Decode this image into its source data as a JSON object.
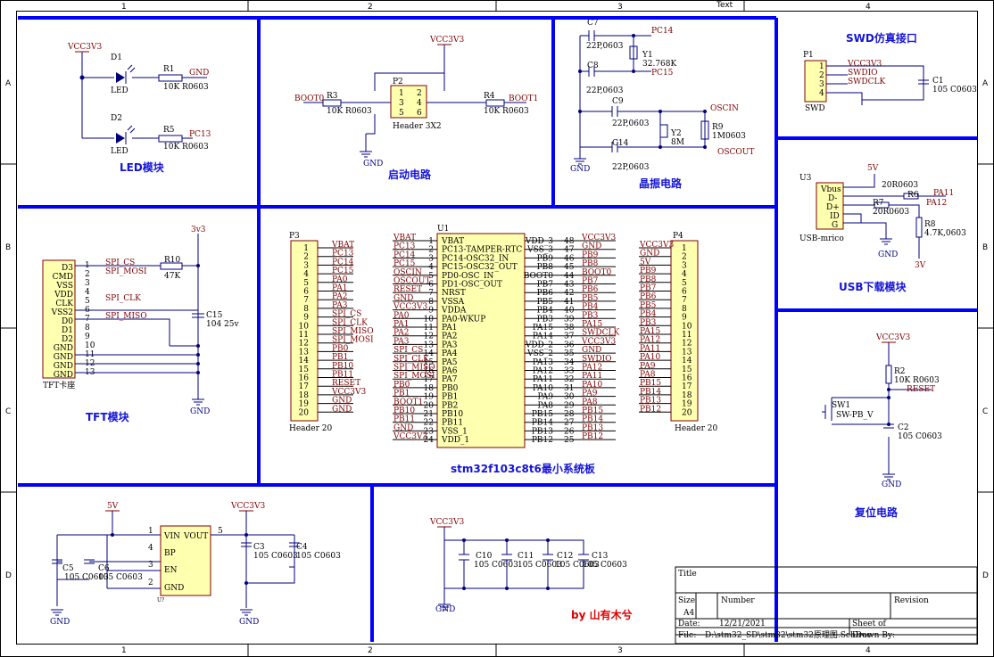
{
  "frame": {
    "cols": [
      "1",
      "2",
      "3",
      "4"
    ],
    "rows": [
      "A",
      "B",
      "C",
      "D"
    ],
    "top_text": "Text"
  },
  "sections": {
    "led": "LED模块",
    "boot": "启动电路",
    "crystal": "晶振电路",
    "swd": "SWD仿真接口",
    "usb": "USB下载模块",
    "tft": "TFT模块",
    "mcu": "stm32f103c8t6最小系统板",
    "reset": "复位电路",
    "author": "by 山有木兮"
  },
  "nets": {
    "vcc3v3": "VCC3V3",
    "gnd": "GND",
    "v5": "5V",
    "v3": "3V",
    "v3v3": "3v3",
    "pc13": "PC13",
    "pc14": "PC14",
    "pc15": "PC15",
    "oscin": "OSCIN",
    "oscout": "OSCOUT",
    "boot0": "BOOT0",
    "boot1": "BOOT1",
    "pa11": "PA11",
    "pa12": "PA12",
    "reset": "RESET",
    "swdio": "SWDIO",
    "swdclk": "SWDCLK",
    "spi_cs": "SPI_CS",
    "spi_mosi": "SPI_MOSI",
    "spi_clk": "SPI_CLK",
    "spi_miso": "SPI_MISO"
  },
  "parts": {
    "d1": "D1",
    "d2": "D2",
    "led": "LED",
    "r1": "R1",
    "r1v": "10K R0603",
    "r5": "R5",
    "r5v": "10K R0603",
    "p2": "P2",
    "p2v": "Header 3X2",
    "r3": "R3",
    "r3v": "10K R0603",
    "r4": "R4",
    "r4v": "10K R0603",
    "c7": "C7",
    "c7v": "22P,0603",
    "c8": "C8",
    "c8v": "22P,0603",
    "c9": "C9",
    "c9v": "22P,0603",
    "c14": "C14",
    "c14v": "22P,0603",
    "y1": "Y1",
    "y1v": "32.768K",
    "y2": "Y2",
    "y2v": "8M",
    "r9": "R9",
    "r9v": "1M0603",
    "p1": "P1",
    "p1v": "SWD",
    "c1": "C1",
    "c1v": "105 C0603",
    "u3": "U3",
    "u3v": "USB-mrico",
    "r6": "R6",
    "r6v": "20R0603",
    "r7": "R7",
    "r7v": "20R0603",
    "r8": "R8",
    "r8v": "4.7K,0603",
    "r10": "R10",
    "r10v": "47K",
    "c15": "C15",
    "c15v": "104 25v",
    "tft": "TFT卡座",
    "p3": "P3",
    "p3v": "Header 20",
    "p4": "P4",
    "p4v": "Header 20",
    "u1": "U1",
    "r2": "R2",
    "r2v": "10K R0603",
    "sw1": "SW1",
    "sw1v": "SW-PB_V",
    "c2": "C2",
    "c2v": "105 C0603",
    "c3": "C3",
    "c3v": "105 C0603",
    "c4": "C4",
    "c4v": "105 C0603",
    "c5": "C5",
    "c5v": "105 C0603",
    "c6": "C6",
    "c6v": "105 C0603",
    "c10": "C10",
    "c10v": "105 C0603",
    "c11": "C11",
    "c11v": "105 C0603",
    "c12": "C12",
    "c12v": "105 C0603",
    "c13": "C13",
    "c13v": "105 C0603",
    "u2": "U?"
  },
  "ldo_pins": {
    "vin": "VIN",
    "vout": "VOUT",
    "bp": "BP",
    "en": "EN",
    "gnd": "GND",
    "n1": "1",
    "n5": "5",
    "n4": "4",
    "n3": "3",
    "n2": "2"
  },
  "usb_pins": [
    "Vbus",
    "D-",
    "D+",
    "ID",
    "G"
  ],
  "tft_pins": [
    "D3",
    "CMD",
    "VSS",
    "VDD",
    "CLK",
    "VSS2",
    "D0",
    "D1",
    "D2",
    "GND",
    "GND",
    "GND",
    "GND"
  ],
  "swd_nums": [
    "1",
    "2",
    "3",
    "4"
  ],
  "mcu_left": [
    "VBAT",
    "PC13-TAMPER-RTC",
    "PC14-OSC32_IN",
    "PC15-OSC32_OUT",
    "PD0-OSC_IN",
    "PD1-OSC_OUT",
    "NRST",
    "VSSA",
    "VDDA",
    "PA0-WKUP",
    "PA1",
    "PA2",
    "PA3",
    "PA4",
    "PA5",
    "PA6",
    "PA7",
    "PB0",
    "PB1",
    "PB2",
    "PB10",
    "PB11",
    "VSS_1",
    "VDD_1"
  ],
  "mcu_left_net": [
    "VBAT",
    "PC13",
    "PC14",
    "PC15",
    "OSCIN",
    "OSCOUT",
    "RESET",
    "GND",
    "VCC3V3",
    "PA0",
    "PA1",
    "PA2",
    "PA3",
    "SPI_CS",
    "SPI_CLK",
    "SPI_MISO",
    "SPI_MOSI",
    "PB0",
    "PB1",
    "BOOT1",
    "PB10",
    "PB11",
    "GND",
    "VCC3V3"
  ],
  "mcu_right": [
    "VDD_3",
    "VSS_3",
    "PB9",
    "PB8",
    "BOOT0",
    "PB7",
    "PB6",
    "PB5",
    "PB4",
    "PB3",
    "PA15",
    "PA14",
    "VDD_2",
    "VSS_2",
    "PA13",
    "PA12",
    "PA11",
    "PA10",
    "PA9",
    "PA8",
    "PB15",
    "PB14",
    "PB13",
    "PB12"
  ],
  "mcu_right_num": [
    "48",
    "47",
    "46",
    "45",
    "44",
    "43",
    "42",
    "41",
    "40",
    "39",
    "38",
    "37",
    "36",
    "35",
    "34",
    "33",
    "32",
    "31",
    "30",
    "29",
    "28",
    "27",
    "26",
    "25"
  ],
  "mcu_right_net": [
    "VCC3V3",
    "GND",
    "PB9",
    "PB8",
    "BOOT0",
    "PB7",
    "PB6",
    "PB5",
    "PB4",
    "PB3",
    "PA15",
    "SWDCLK",
    "VCC3V3",
    "GND",
    "SWDIO",
    "PA12",
    "PA11",
    "PA10",
    "PA9",
    "PA8",
    "PB15",
    "PB14",
    "PB13",
    "PB12"
  ],
  "p3_nets": [
    "VBAT",
    "PC13",
    "PC14",
    "PC15",
    "PA0",
    "PA1",
    "PA2",
    "PA3",
    "SPI_CS",
    "SPI_CLK",
    "SPI_MISO",
    "SPI_MOSI",
    "PB0",
    "PB1",
    "PB10",
    "PB11",
    "RESET",
    "VCC3V3",
    "GND",
    "GND"
  ],
  "p4_nets": [
    "VCC3V3",
    "GND",
    "5V",
    "PB9",
    "PB8",
    "PB7",
    "PB6",
    "PB5",
    "PB4",
    "PB3",
    "PA15",
    "PA12",
    "PA11",
    "PA10",
    "PA9",
    "PA8",
    "PB15",
    "PB14",
    "PB13",
    "PB12"
  ],
  "titleblock": {
    "title": "Title",
    "size": "Size",
    "size_v": "A4",
    "number": "Number",
    "revision": "Revision",
    "date": "Date:",
    "date_v": "12/21/2021",
    "sheet": "Sheet    of",
    "file": "File:",
    "file_v": "D:\\stm32_SD\\stm32\\stm32原理图.SchDoc",
    "drawn": "Drawn By:"
  }
}
